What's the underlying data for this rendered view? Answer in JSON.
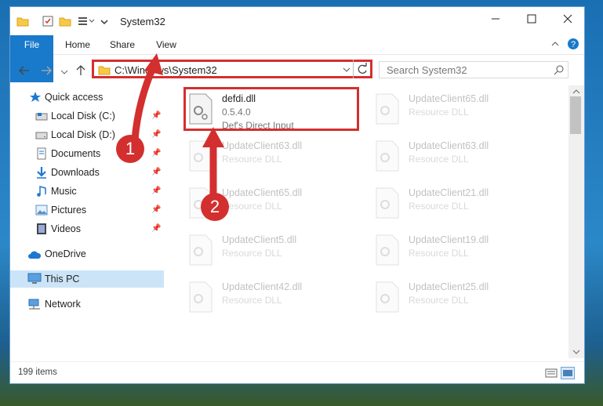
{
  "window": {
    "title": "System32"
  },
  "ribbon": {
    "tabs": [
      "File",
      "Home",
      "Share",
      "View"
    ]
  },
  "address": {
    "path": "C:\\Windows\\System32"
  },
  "search": {
    "placeholder": "Search System32"
  },
  "sidebar": {
    "items": [
      {
        "label": "Quick access"
      },
      {
        "label": "Local Disk (C:)"
      },
      {
        "label": "Local Disk (D:)"
      },
      {
        "label": "Documents"
      },
      {
        "label": "Downloads"
      },
      {
        "label": "Music"
      },
      {
        "label": "Pictures"
      },
      {
        "label": "Videos"
      },
      {
        "label": "OneDrive"
      },
      {
        "label": "This PC"
      },
      {
        "label": "Network"
      }
    ]
  },
  "files": {
    "highlighted": {
      "name": "defdi.dll",
      "version": "0.5.4.0",
      "description": "Def's Direct Input"
    },
    "left": [
      {
        "name": "UpdateClient63.dll",
        "type": "Resource DLL"
      },
      {
        "name": "UpdateClient65.dll",
        "type": "Resource DLL"
      },
      {
        "name": "UpdateClient5.dll",
        "type": "Resource DLL"
      },
      {
        "name": "UpdateClient42.dll",
        "type": "Resource DLL"
      }
    ],
    "right": [
      {
        "name": "UpdateClient65.dll",
        "type": "Resource DLL"
      },
      {
        "name": "UpdateClient63.dll",
        "type": "Resource DLL"
      },
      {
        "name": "UpdateClient21.dll",
        "type": "Resource DLL"
      },
      {
        "name": "UpdateClient19.dll",
        "type": "Resource DLL"
      },
      {
        "name": "UpdateClient25.dll",
        "type": "Resource DLL"
      }
    ]
  },
  "status": {
    "count": "199 items"
  },
  "annotations": {
    "badge1": "1",
    "badge2": "2"
  },
  "colors": {
    "accent": "#1979ca",
    "annotation": "#d32f2f"
  }
}
